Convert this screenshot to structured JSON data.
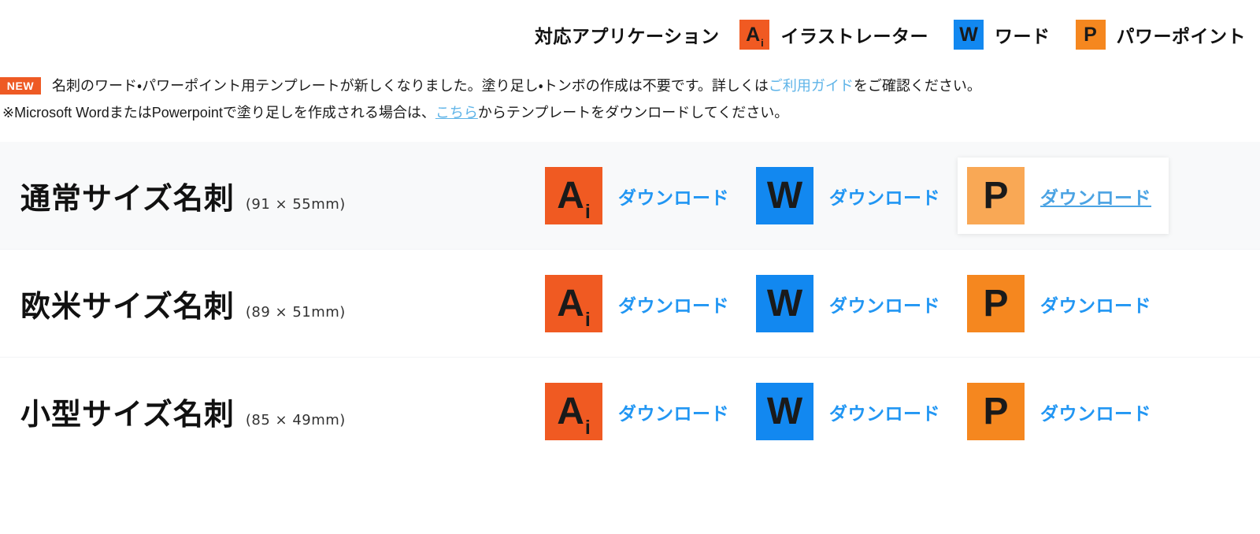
{
  "legend": {
    "title": "対応アプリケーション",
    "items": [
      {
        "icon": "illustrator-icon",
        "icon_glyph": "Ai",
        "label": "イラストレーター",
        "color": "#F05A22"
      },
      {
        "icon": "word-icon",
        "icon_glyph": "W",
        "label": "ワード",
        "color": "#1288F0"
      },
      {
        "icon": "powerpoint-icon",
        "icon_glyph": "P",
        "label": "パワーポイント",
        "color": "#F5871F"
      }
    ]
  },
  "notice": {
    "badge": "NEW",
    "line1_a": "名刺のワード・パワーポイント用テンプレートが新しくなりました。塗り足し・トンボの作成は不要です。詳しくは",
    "line1_link": "ご利用ガイド",
    "line1_b": "をご確認ください。",
    "line2_a": "※Microsoft WordまたはPowerpointで塗り足しを作成される場合は、",
    "line2_link": "こちら",
    "line2_b": "からテンプレートをダウンロードしてください。",
    "link_color": "#5FB4E8"
  },
  "rows": [
    {
      "title": "通常サイズ名刺",
      "dims": "(91 × 55mm)",
      "shaded": true,
      "downloads": [
        {
          "app": "illustrator",
          "icon_glyph": "Ai",
          "label": "ダウンロード",
          "hovered": false
        },
        {
          "app": "word",
          "icon_glyph": "W",
          "label": "ダウンロード",
          "hovered": false
        },
        {
          "app": "powerpoint",
          "icon_glyph": "P",
          "label": "ダウンロード",
          "hovered": true
        }
      ]
    },
    {
      "title": "欧米サイズ名刺",
      "dims": "(89 × 51mm)",
      "shaded": false,
      "downloads": [
        {
          "app": "illustrator",
          "icon_glyph": "Ai",
          "label": "ダウンロード",
          "hovered": false
        },
        {
          "app": "word",
          "icon_glyph": "W",
          "label": "ダウンロード",
          "hovered": false
        },
        {
          "app": "powerpoint",
          "icon_glyph": "P",
          "label": "ダウンロード",
          "hovered": false
        }
      ]
    },
    {
      "title": "小型サイズ名刺",
      "dims": "(85 × 49mm)",
      "shaded": false,
      "downloads": [
        {
          "app": "illustrator",
          "icon_glyph": "Ai",
          "label": "ダウンロード",
          "hovered": false
        },
        {
          "app": "word",
          "icon_glyph": "W",
          "label": "ダウンロード",
          "hovered": false
        },
        {
          "app": "powerpoint",
          "icon_glyph": "P",
          "label": "ダウンロード",
          "hovered": false
        }
      ]
    }
  ],
  "colors": {
    "illustrator": "#F05A22",
    "word": "#1288F0",
    "powerpoint": "#F5871F",
    "powerpoint_faded": "#F9A855",
    "link": "#2196F3",
    "badge": "#EE5A24",
    "row_shade": "#F8F9FA"
  }
}
